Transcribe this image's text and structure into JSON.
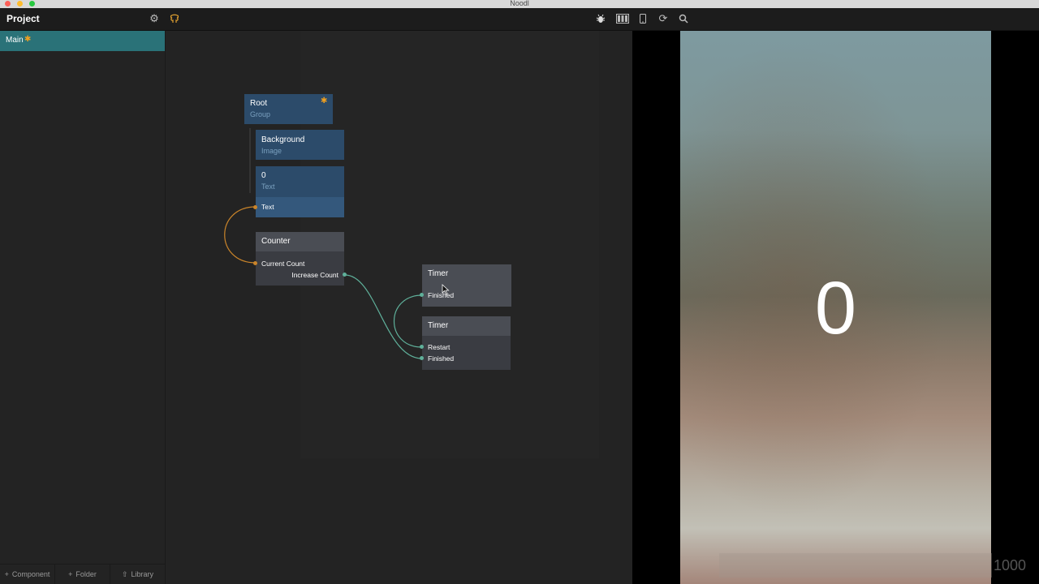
{
  "window": {
    "title": "Noodl"
  },
  "toolbar": {
    "project_label": "Project",
    "icons": [
      "gear-icon",
      "brain-icon",
      "bug-icon",
      "layout-icon",
      "device-icon",
      "refresh-icon",
      "search-icon"
    ]
  },
  "sidebar": {
    "items": [
      {
        "label": "Main",
        "star": "✱"
      }
    ],
    "footer": [
      {
        "icon": "+",
        "label": "Component"
      },
      {
        "icon": "+",
        "label": "Folder"
      },
      {
        "icon": "⇧",
        "label": "Library"
      }
    ]
  },
  "nodes": {
    "root": {
      "title": "Root",
      "type": "Group",
      "star": "✱"
    },
    "background": {
      "title": "Background",
      "type": "Image"
    },
    "text": {
      "title": "0",
      "type": "Text",
      "port": "Text"
    },
    "counter": {
      "title": "Counter",
      "port_current": "Current Count",
      "port_increase": "Increase Count"
    },
    "timer1": {
      "title": "Timer",
      "port_finished": "Finished"
    },
    "timer2": {
      "title": "Timer",
      "port_restart": "Restart",
      "port_finished": "Finished"
    }
  },
  "preview": {
    "counter_value": "0",
    "fps": "1000"
  },
  "colors": {
    "accent": "#2a7278",
    "star": "#f0a020",
    "connection_orange": "#c9842a",
    "connection_teal": "#5fb09a"
  }
}
